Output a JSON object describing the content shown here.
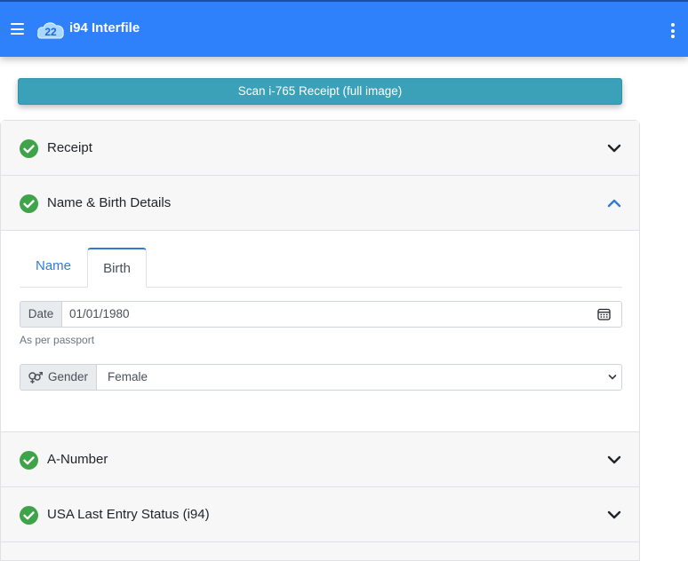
{
  "appbar": {
    "title": "i94 Interfile",
    "logo_text": "22"
  },
  "scan_button": {
    "label": "Scan i-765 Receipt (full image)"
  },
  "sections": [
    {
      "title": "Receipt",
      "expanded": false
    },
    {
      "title": "Name & Birth Details",
      "expanded": true
    },
    {
      "title": "A-Number",
      "expanded": false
    },
    {
      "title": "USA Last Entry Status (i94)",
      "expanded": false
    }
  ],
  "tabs": {
    "name_label": "Name",
    "birth_label": "Birth",
    "active": "Birth"
  },
  "birth_form": {
    "date_label": "Date",
    "date_value": "01/01/1980",
    "date_helper": "As per passport",
    "gender_label": "Gender",
    "gender_value": "Female"
  },
  "colors": {
    "appbar": "#2f80fb",
    "scan_button": "#3aa1b8",
    "check": "#3fa349",
    "tab_accent": "#2f7bd6"
  },
  "icons": [
    "menu-icon",
    "kebab-menu-icon",
    "check-circle-icon",
    "chevron-down-icon",
    "chevron-up-icon",
    "calendar-icon",
    "gender-icon"
  ]
}
